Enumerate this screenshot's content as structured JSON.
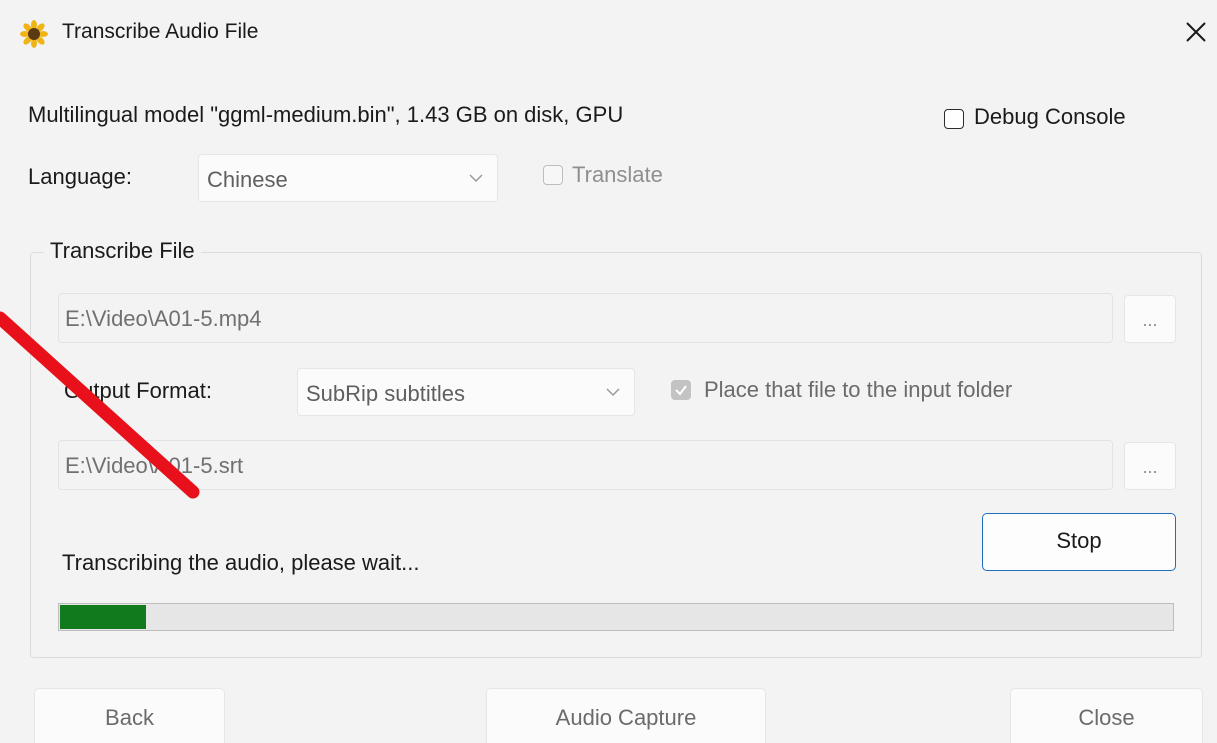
{
  "window": {
    "title": "Transcribe Audio File",
    "icon": "sunflower-icon",
    "close_icon": "close-icon"
  },
  "model": {
    "description": "Multilingual model \"ggml-medium.bin\", 1.43 GB on disk, GPU"
  },
  "debug_console": {
    "label": "Debug Console",
    "checked": false
  },
  "language": {
    "label": "Language:",
    "selected": "Chinese",
    "translate_label": "Translate",
    "translate_checked": false
  },
  "transcribe_file": {
    "group_title": "Transcribe File",
    "input_path": "E:\\Video\\A01-5.mp4",
    "browse_label": "...",
    "output_format_label": "Output Format:",
    "output_format_selected": "SubRip subtitles",
    "place_in_input_folder_label": "Place that file to the input folder",
    "place_in_input_folder_checked": true,
    "output_path": "E:\\Video\\A01-5.srt",
    "output_browse_label": "...",
    "stop_label": "Stop",
    "status_text": "Transcribing the audio, please wait...",
    "progress_fraction": 0.077
  },
  "footer": {
    "back_label": "Back",
    "audio_capture_label": "Audio Capture",
    "close_label": "Close"
  },
  "colors": {
    "accent": "#1f6fbf",
    "progress_fill": "#117a1c",
    "annotation_red": "#e8101a"
  }
}
